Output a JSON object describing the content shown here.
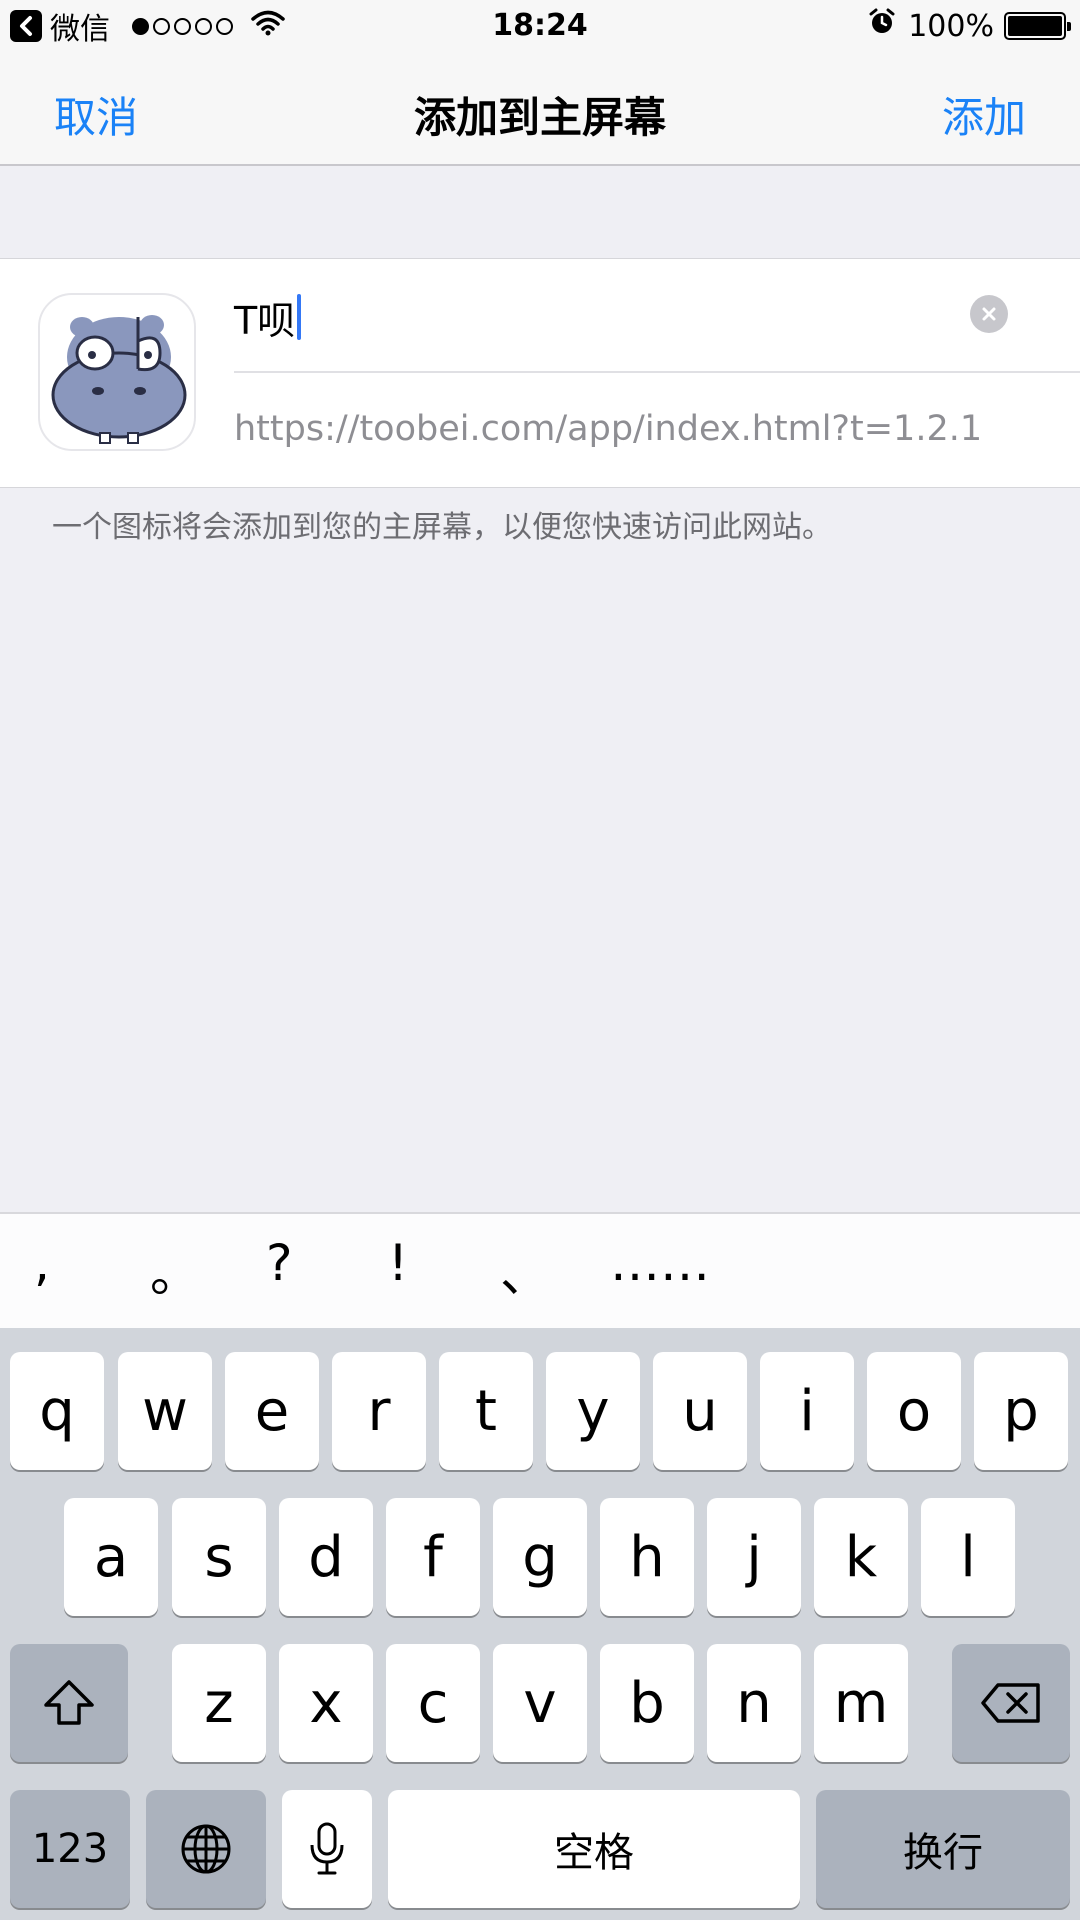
{
  "status_bar": {
    "back_app": "微信",
    "time": "18:24",
    "battery": "100%",
    "signal_bars_filled": 1,
    "signal_bars_total": 5
  },
  "nav": {
    "cancel": "取消",
    "title": "添加到主屏幕",
    "add": "添加"
  },
  "form": {
    "title_value": "T呗",
    "url": "https://toobei.com/app/index.html?t=1.2.1"
  },
  "hint": "一个图标将会添加到您的主屏幕，以便您快速访问此网站。",
  "keyboard": {
    "candidates": [
      ",",
      "。",
      "?",
      "!",
      "、",
      "……"
    ],
    "row1": [
      "q",
      "w",
      "e",
      "r",
      "t",
      "y",
      "u",
      "i",
      "o",
      "p"
    ],
    "row2": [
      "a",
      "s",
      "d",
      "f",
      "g",
      "h",
      "j",
      "k",
      "l"
    ],
    "row3": [
      "z",
      "x",
      "c",
      "v",
      "b",
      "n",
      "m"
    ],
    "numbers": "123",
    "space": "空格",
    "return": "换行"
  },
  "colors": {
    "accent": "#1a82f7",
    "background": "#efeff4",
    "keyboard_bg": "#d1d5db"
  }
}
